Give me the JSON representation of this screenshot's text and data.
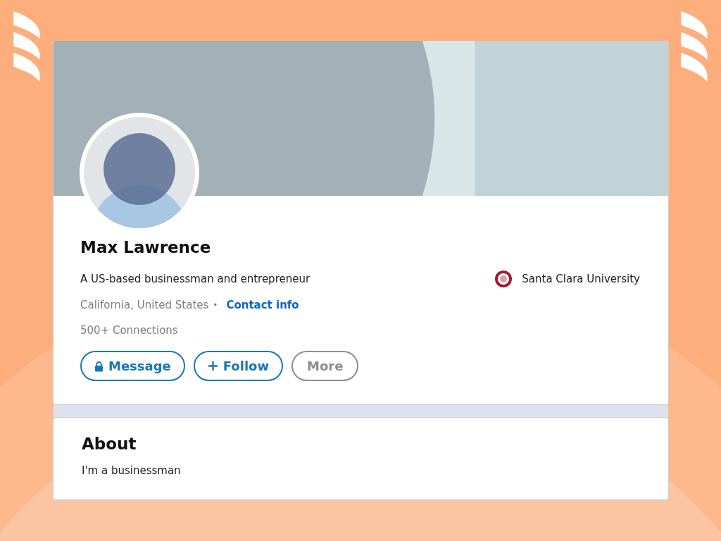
{
  "profile": {
    "name": "Max Lawrence",
    "headline": "A US-based businessman and entrepreneur",
    "location": "California, United States",
    "separator": "•",
    "contact_link": "Contact info",
    "connections": "500+ Connections",
    "education": {
      "school": "Santa Clara University"
    },
    "buttons": [
      {
        "label": "Message",
        "kind": "message"
      },
      {
        "label": "Follow",
        "kind": "follow"
      },
      {
        "label": "More",
        "kind": "more"
      }
    ]
  },
  "about": {
    "title": "About",
    "text": "I'm a businessman"
  }
}
